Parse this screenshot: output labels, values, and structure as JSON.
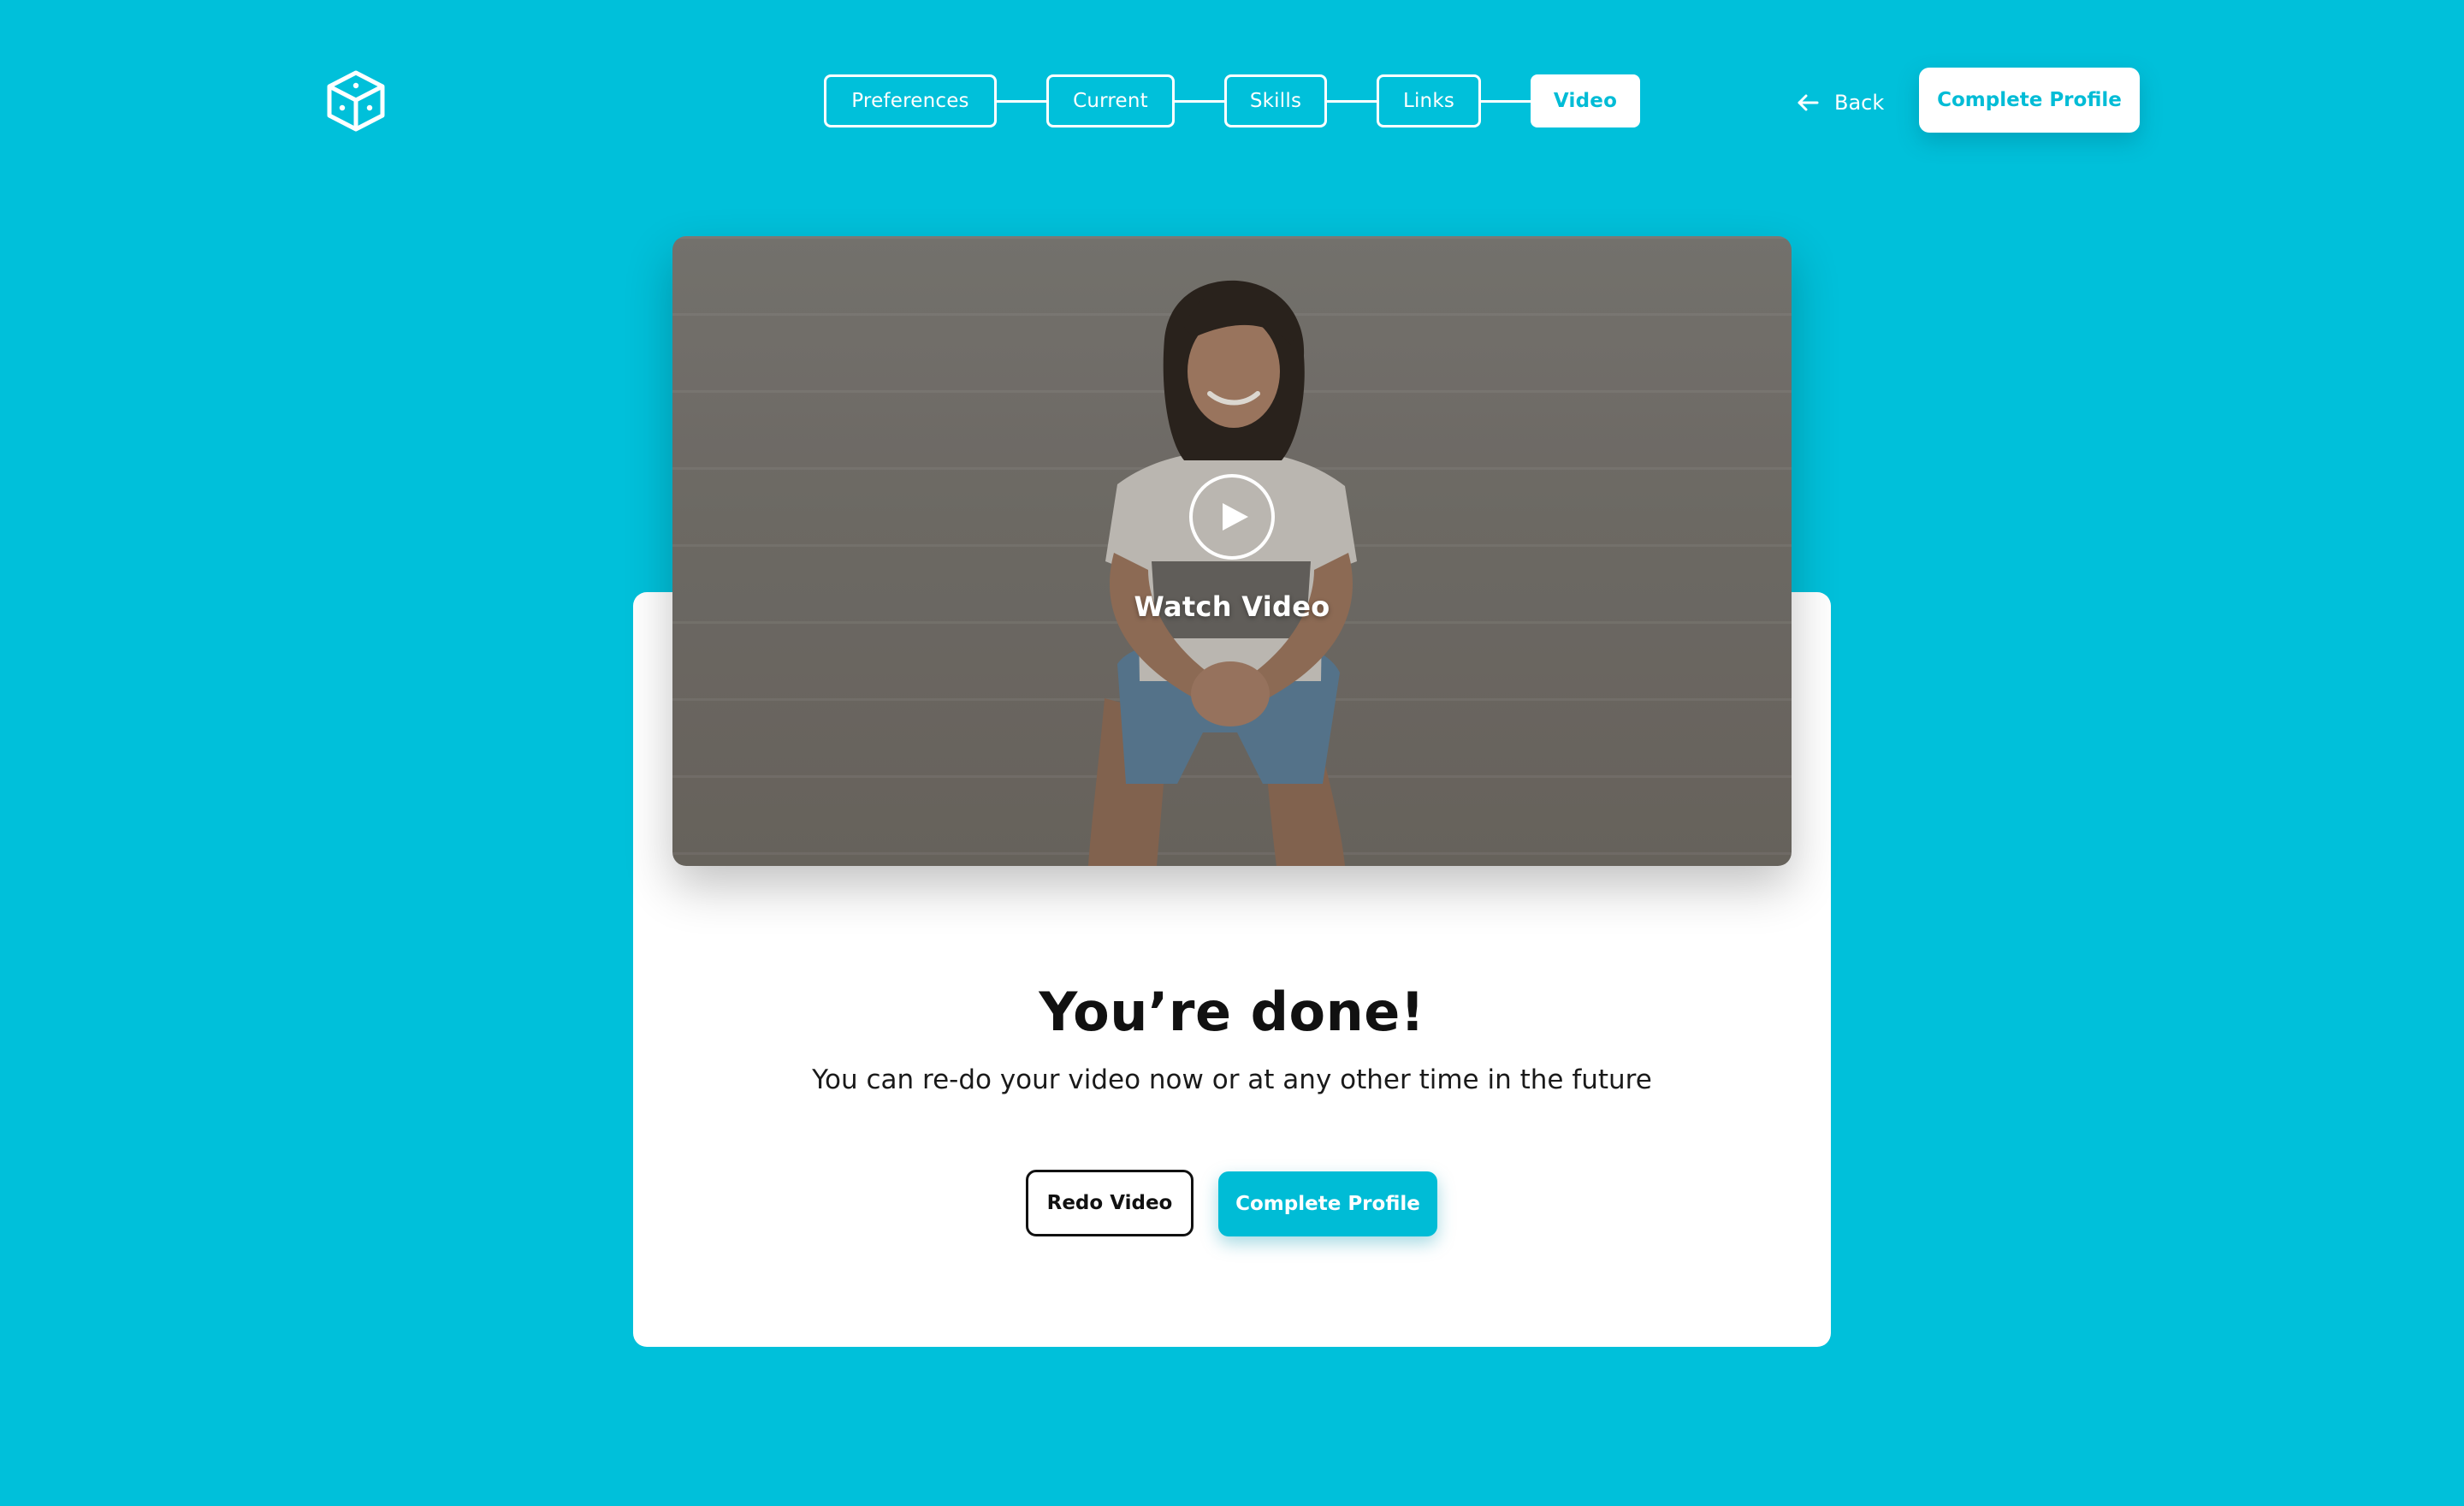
{
  "header": {
    "logo_icon": "cube-dice-icon",
    "steps": [
      {
        "label": "Preferences",
        "active": false
      },
      {
        "label": "Current",
        "active": false
      },
      {
        "label": "Skills",
        "active": false
      },
      {
        "label": "Links",
        "active": false
      },
      {
        "label": "Video",
        "active": true
      }
    ],
    "back_label": "Back",
    "back_icon": "arrow-left-icon",
    "cta_label": "Complete Profile"
  },
  "video": {
    "play_icon": "play-icon",
    "watch_label": "Watch Video"
  },
  "card": {
    "title": "You’re done!",
    "subtitle": "You can re-do your video now or at any other time in the future",
    "redo_label": "Redo Video",
    "complete_label": "Complete Profile"
  },
  "colors": {
    "background": "#00c0da",
    "accent": "#00bcd6",
    "card": "#ffffff",
    "text": "#111111"
  }
}
